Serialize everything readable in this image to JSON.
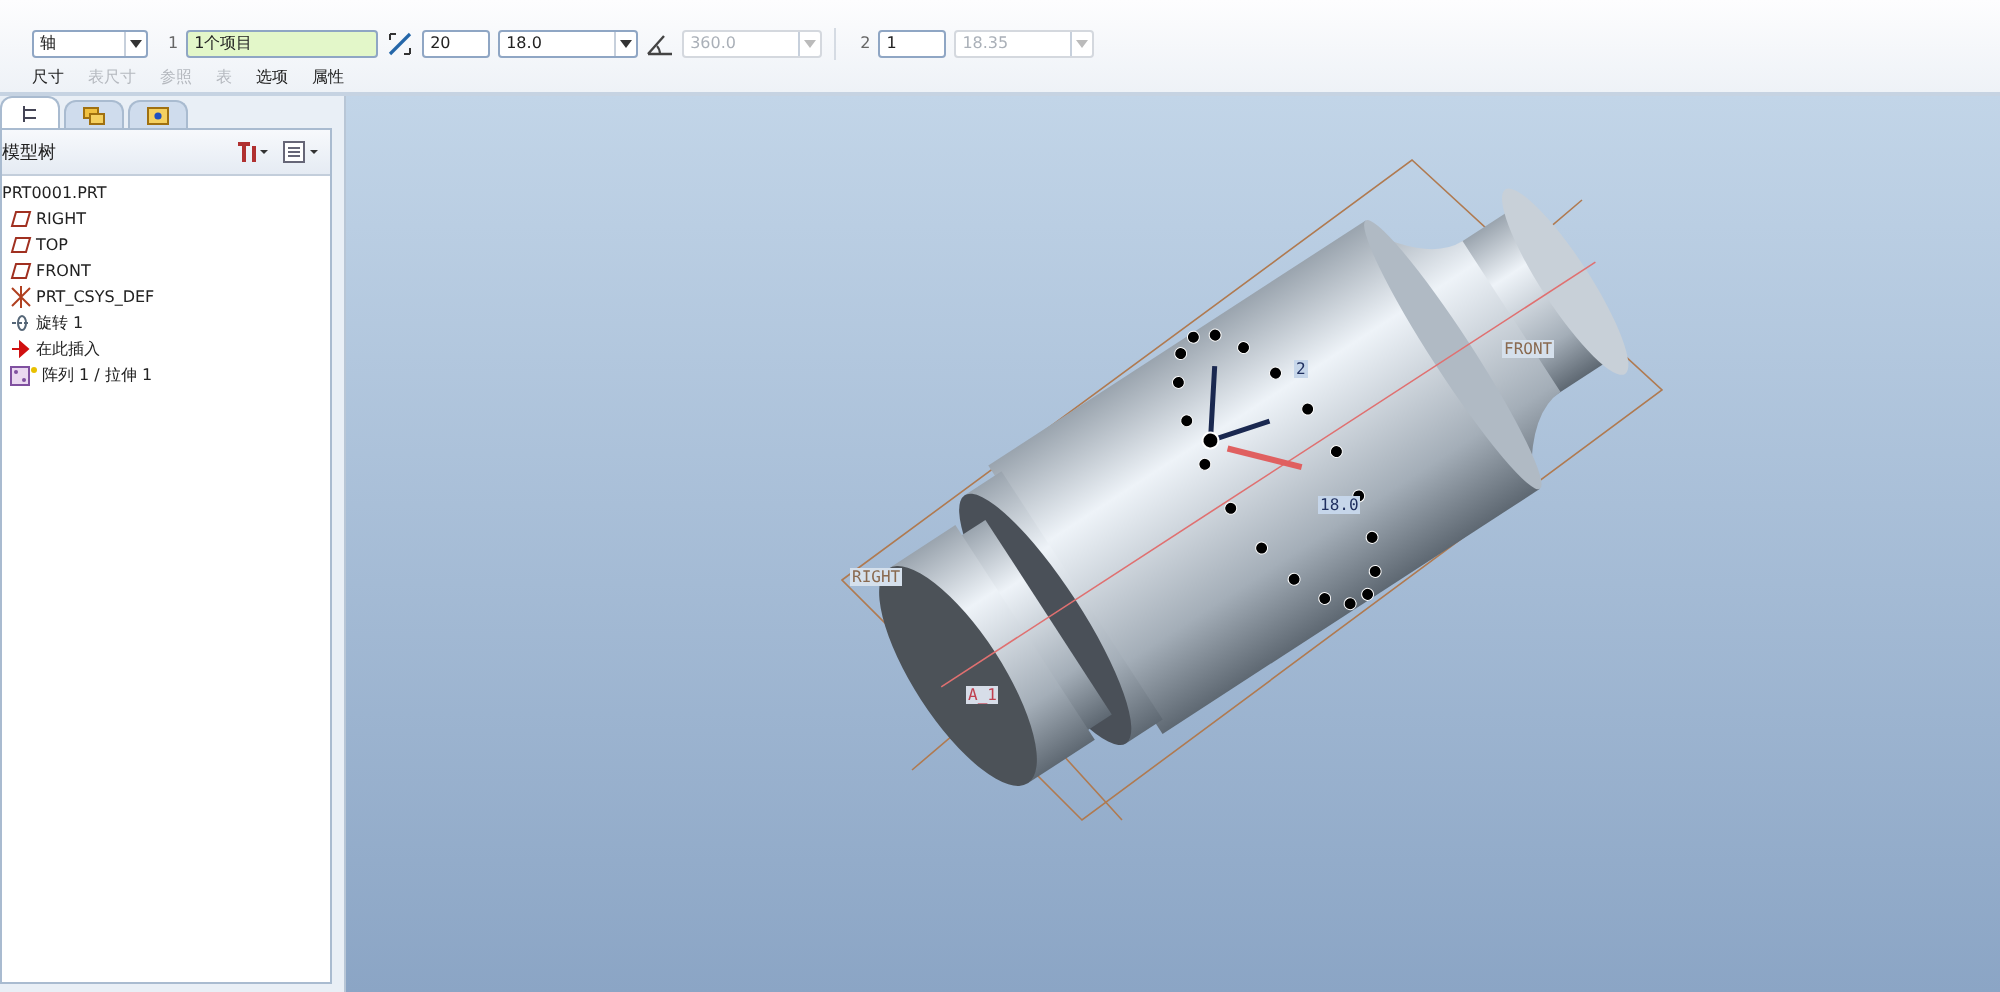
{
  "dashboard": {
    "controls": [
      {
        "kind": "dropdown",
        "value": "轴",
        "disabled": false
      },
      {
        "kind": "label",
        "text": "1"
      },
      {
        "kind": "collector",
        "value": "1个项目",
        "disabled": false
      },
      {
        "kind": "count_icon"
      },
      {
        "kind": "input",
        "value": "20",
        "disabled": false
      },
      {
        "kind": "combo",
        "value": "18.0",
        "disabled": false
      },
      {
        "kind": "angle_icon"
      },
      {
        "kind": "combo",
        "value": "360.0",
        "disabled": true
      },
      {
        "kind": "separator"
      },
      {
        "kind": "label",
        "text": "2"
      },
      {
        "kind": "input",
        "value": "1",
        "disabled": false
      },
      {
        "kind": "combo",
        "value": "18.35",
        "disabled": true
      }
    ],
    "tabs": [
      {
        "label": "尺寸",
        "disabled": false
      },
      {
        "label": "表尺寸",
        "disabled": true
      },
      {
        "label": "参照",
        "disabled": true
      },
      {
        "label": "表",
        "disabled": true
      },
      {
        "label": "选项",
        "disabled": false
      },
      {
        "label": "属性",
        "disabled": false
      }
    ]
  },
  "navigator": {
    "tabs": [
      {
        "selected": true
      },
      {
        "selected": false
      },
      {
        "selected": false
      }
    ],
    "title": "模型树",
    "tree": {
      "label": "PRT0001.PRT",
      "children": [
        {
          "kind": "plane",
          "label": "RIGHT"
        },
        {
          "kind": "plane",
          "label": "TOP"
        },
        {
          "kind": "plane",
          "label": "FRONT"
        },
        {
          "kind": "csys",
          "label": "PRT_CSYS_DEF"
        },
        {
          "kind": "revolve",
          "label": "旋转 1"
        },
        {
          "kind": "insert",
          "label": "在此插入"
        },
        {
          "kind": "pattern",
          "label": "阵列 1 / 拉伸 1"
        }
      ]
    }
  },
  "viewport": {
    "labels": [
      {
        "kind": "datum",
        "text": "RIGHT"
      },
      {
        "kind": "datum",
        "text": "FRONT"
      },
      {
        "kind": "axis",
        "text": "A_1"
      },
      {
        "kind": "dim",
        "text": "2"
      },
      {
        "kind": "dim",
        "text": "18.0"
      }
    ]
  }
}
